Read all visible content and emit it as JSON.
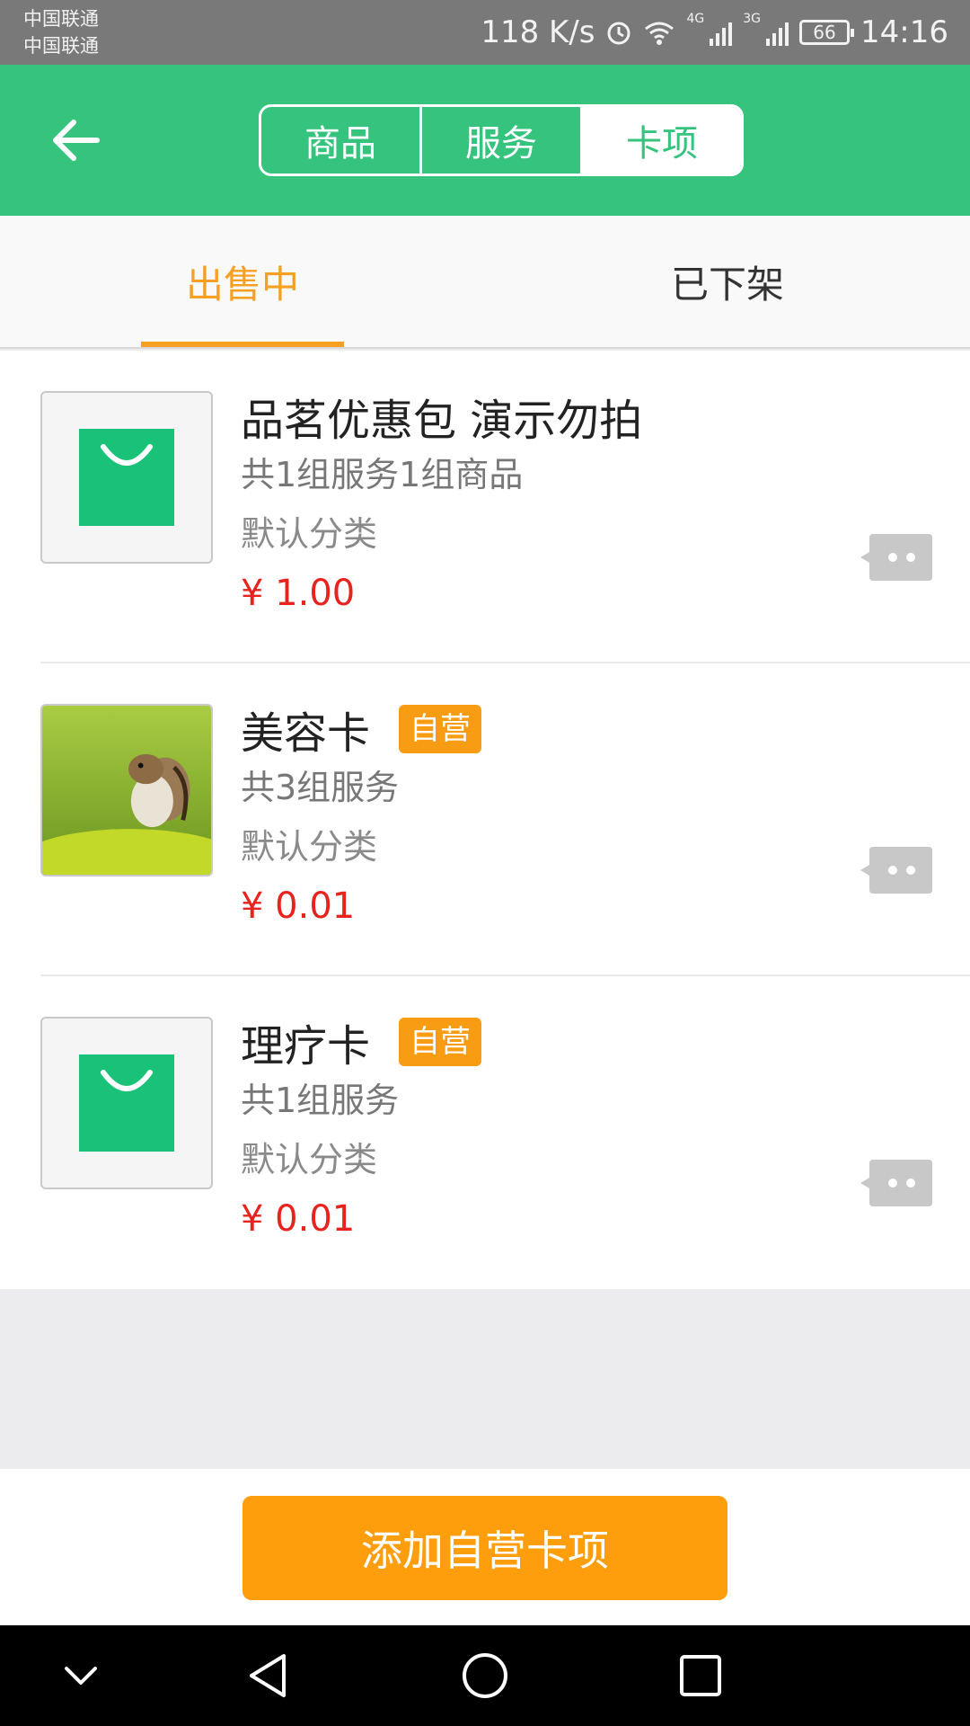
{
  "status_bar": {
    "carrier_1": "中国联通",
    "carrier_2": "中国联通",
    "speed": "118 K/s",
    "net_4g": "4G",
    "net_3g": "3G",
    "battery": "66",
    "time": "14:16",
    "icons": [
      "alarm-icon",
      "wifi-icon",
      "signal-4g-icon",
      "signal-3g-icon",
      "battery-icon"
    ]
  },
  "header": {
    "back_icon": "arrow-left-icon",
    "segments": [
      {
        "label": "商品",
        "active": false
      },
      {
        "label": "服务",
        "active": false
      },
      {
        "label": "卡项",
        "active": true
      }
    ]
  },
  "subtabs": [
    {
      "label": "出售中",
      "active": true
    },
    {
      "label": "已下架",
      "active": false
    }
  ],
  "items": [
    {
      "title": "品茗优惠包 演示勿拍",
      "badge": "",
      "desc": "共1组服务1组商品",
      "category": "默认分类",
      "price": "¥ 1.00",
      "image": "shopping-bag-icon"
    },
    {
      "title": "美容卡",
      "badge": "自营",
      "desc": "共3组服务",
      "category": "默认分类",
      "price": "¥ 0.01",
      "image": "chipmunk-photo"
    },
    {
      "title": "理疗卡",
      "badge": "自营",
      "desc": "共1组服务",
      "category": "默认分类",
      "price": "¥ 0.01",
      "image": "shopping-bag-icon"
    }
  ],
  "add_button": "添加自营卡项",
  "nav": [
    "chevron-down-icon",
    "back-triangle-icon",
    "home-circle-icon",
    "recents-square-icon"
  ],
  "colors": {
    "primary_green": "#36c37e",
    "accent_orange": "#f6a023",
    "price_red": "#e8231d",
    "badge_orange": "#f89d13"
  }
}
